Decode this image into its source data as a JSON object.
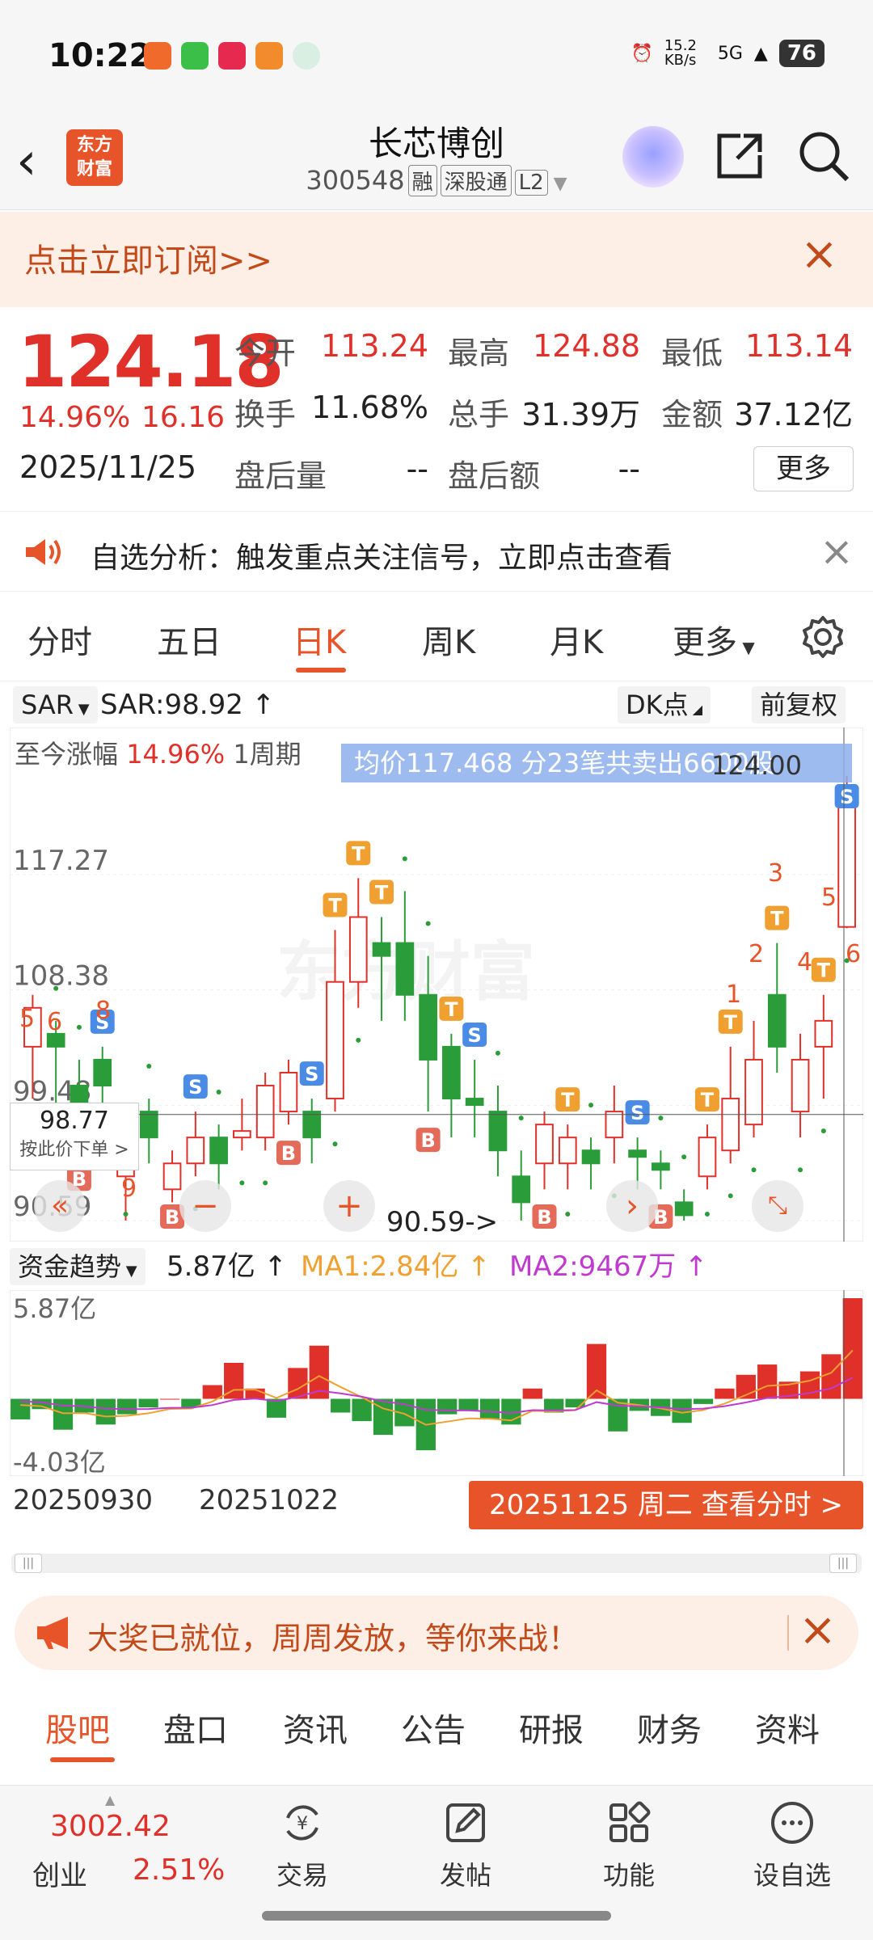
{
  "status_bar": {
    "time": "10:22",
    "net_speed": "15.2 KB/s",
    "net_type": "5G",
    "battery": "76"
  },
  "header": {
    "back_icon": "chevron-left-icon",
    "logo_text_1": "东方",
    "logo_text_2": "财富",
    "stock_name": "长芯博创",
    "stock_code": "300548",
    "tags": [
      "融",
      "深股通",
      "L2"
    ]
  },
  "subscribe_banner": {
    "text": "点击立即订阅>>"
  },
  "quote": {
    "price": "124.18",
    "change_pct": "14.96%",
    "change": "16.16",
    "date": "2025/11/25",
    "open_label": "今开",
    "open": "113.24",
    "high_label": "最高",
    "high": "124.88",
    "low_label": "最低",
    "low": "113.14",
    "turnover_label": "换手",
    "turnover": "11.68%",
    "volume_label": "总手",
    "volume": "31.39万",
    "amount_label": "金额",
    "amount": "37.12亿",
    "after_vol_label": "盘后量",
    "after_vol": "--",
    "after_amt_label": "盘后额",
    "after_amt": "--",
    "more": "更多"
  },
  "notice": {
    "text": "自选分析：触发重点关注信号，立即点击查看"
  },
  "chart_tabs": [
    "分时",
    "五日",
    "日K",
    "周K",
    "月K",
    "更多"
  ],
  "chart_toolbar": {
    "indicator": "SAR",
    "indicator_value": "SAR:98.92 ↑",
    "dk": "DK点",
    "adjust": "前复权"
  },
  "chart_overlay": {
    "range_text": "至今涨幅",
    "range_pct": "14.96%",
    "range_period": "1周期",
    "tooltip": "均价117.468   分23笔共卖出6600股",
    "price_box_value": "98.77",
    "price_box_sub": "按此价下单 >",
    "price_marker": "124.00",
    "low_marker": "90.59->"
  },
  "chart_data": {
    "type": "candlestick",
    "y_ticks": [
      "117.27",
      "108.38",
      "99.48",
      "90.59"
    ],
    "ylim": [
      90.59,
      124.88
    ],
    "marker_digits": [
      "5",
      "6",
      "8",
      "9",
      "3",
      "2",
      "1",
      "4",
      "5",
      "6"
    ],
    "signal_labels": [
      "S",
      "B",
      "T"
    ],
    "candles": [
      {
        "o": 104,
        "c": 107,
        "h": 108,
        "l": 100
      },
      {
        "o": 105,
        "c": 104,
        "h": 106,
        "l": 96
      },
      {
        "o": 101,
        "c": 99,
        "h": 103,
        "l": 96
      },
      {
        "o": 103,
        "c": 101,
        "h": 104,
        "l": 96
      },
      {
        "o": 94,
        "c": 96,
        "h": 97,
        "l": 90.59
      },
      {
        "o": 99,
        "c": 97,
        "h": 100,
        "l": 95
      },
      {
        "o": 93,
        "c": 95,
        "h": 96,
        "l": 92
      },
      {
        "o": 95,
        "c": 97,
        "h": 99,
        "l": 94
      },
      {
        "o": 97,
        "c": 95,
        "h": 98,
        "l": 93
      },
      {
        "o": 97,
        "c": 97.5,
        "h": 100,
        "l": 96
      },
      {
        "o": 97,
        "c": 101,
        "h": 102,
        "l": 96
      },
      {
        "o": 99,
        "c": 102,
        "h": 103,
        "l": 98
      },
      {
        "o": 99,
        "c": 97,
        "h": 100,
        "l": 95
      },
      {
        "o": 100,
        "c": 109,
        "h": 113,
        "l": 99
      },
      {
        "o": 109,
        "c": 114,
        "h": 117,
        "l": 107
      },
      {
        "o": 112,
        "c": 111,
        "h": 114,
        "l": 106
      },
      {
        "o": 112,
        "c": 108,
        "h": 116,
        "l": 106
      },
      {
        "o": 108,
        "c": 103,
        "h": 111,
        "l": 99
      },
      {
        "o": 104,
        "c": 100,
        "h": 105,
        "l": 97
      },
      {
        "o": 100,
        "c": 99.5,
        "h": 103,
        "l": 97
      },
      {
        "o": 99,
        "c": 96,
        "h": 101,
        "l": 94
      },
      {
        "o": 94,
        "c": 92,
        "h": 96,
        "l": 90.59
      },
      {
        "o": 95,
        "c": 98,
        "h": 99,
        "l": 93
      },
      {
        "o": 95,
        "c": 97,
        "h": 98,
        "l": 93
      },
      {
        "o": 96,
        "c": 95,
        "h": 97,
        "l": 93
      },
      {
        "o": 97,
        "c": 99,
        "h": 101,
        "l": 95
      },
      {
        "o": 96,
        "c": 95.5,
        "h": 97,
        "l": 93
      },
      {
        "o": 95,
        "c": 94.5,
        "h": 96,
        "l": 93
      },
      {
        "o": 92,
        "c": 91,
        "h": 93,
        "l": 90.59
      },
      {
        "o": 94,
        "c": 97,
        "h": 98,
        "l": 93
      },
      {
        "o": 96,
        "c": 100,
        "h": 104,
        "l": 95
      },
      {
        "o": 98,
        "c": 103,
        "h": 106,
        "l": 97
      },
      {
        "o": 108,
        "c": 104,
        "h": 112,
        "l": 102
      },
      {
        "o": 99,
        "c": 103,
        "h": 105,
        "l": 97
      },
      {
        "o": 104,
        "c": 106,
        "h": 108,
        "l": 100
      },
      {
        "o": 113.24,
        "c": 124.18,
        "h": 124.88,
        "l": 113.14
      }
    ]
  },
  "fund_trend": {
    "label": "资金趋势",
    "value": "5.87亿 ↑",
    "ma1": "MA1:2.84亿 ↑",
    "ma2": "MA2:9467万 ↑",
    "max_label": "5.87亿",
    "min_label": "-4.03亿",
    "bars": [
      -1.2,
      -0.6,
      -1.8,
      -0.8,
      -1.5,
      -0.9,
      -0.5,
      0.0,
      -0.5,
      0.8,
      2.1,
      0.6,
      -1.1,
      1.8,
      3.1,
      -0.8,
      -1.3,
      -2.1,
      -1.6,
      -3.0,
      -0.9,
      -0.7,
      -1.2,
      -1.5,
      0.6,
      -0.8,
      -0.5,
      3.2,
      -1.9,
      -0.7,
      -1.0,
      -1.4,
      -0.3,
      0.6,
      1.4,
      2.0,
      1.0,
      1.6,
      2.6,
      5.87
    ]
  },
  "dates": {
    "start": "20250930",
    "mid": "20251022",
    "current": "20251125 周二 查看分时 >"
  },
  "promo": {
    "text": "大奖已就位，周周发放，等你来战！"
  },
  "bottom_tabs": [
    "股吧",
    "盘口",
    "资讯",
    "公告",
    "研报",
    "财务",
    "资料"
  ],
  "footer": {
    "index_value": "3002.42",
    "index_name": "创业",
    "index_pct": "2.51%",
    "items": [
      "交易",
      "发帖",
      "功能",
      "设自选"
    ]
  },
  "colors": {
    "up": "#e0302a",
    "down": "#2a9d3a",
    "accent": "#e8542a",
    "sar": "#2a9d3a"
  }
}
